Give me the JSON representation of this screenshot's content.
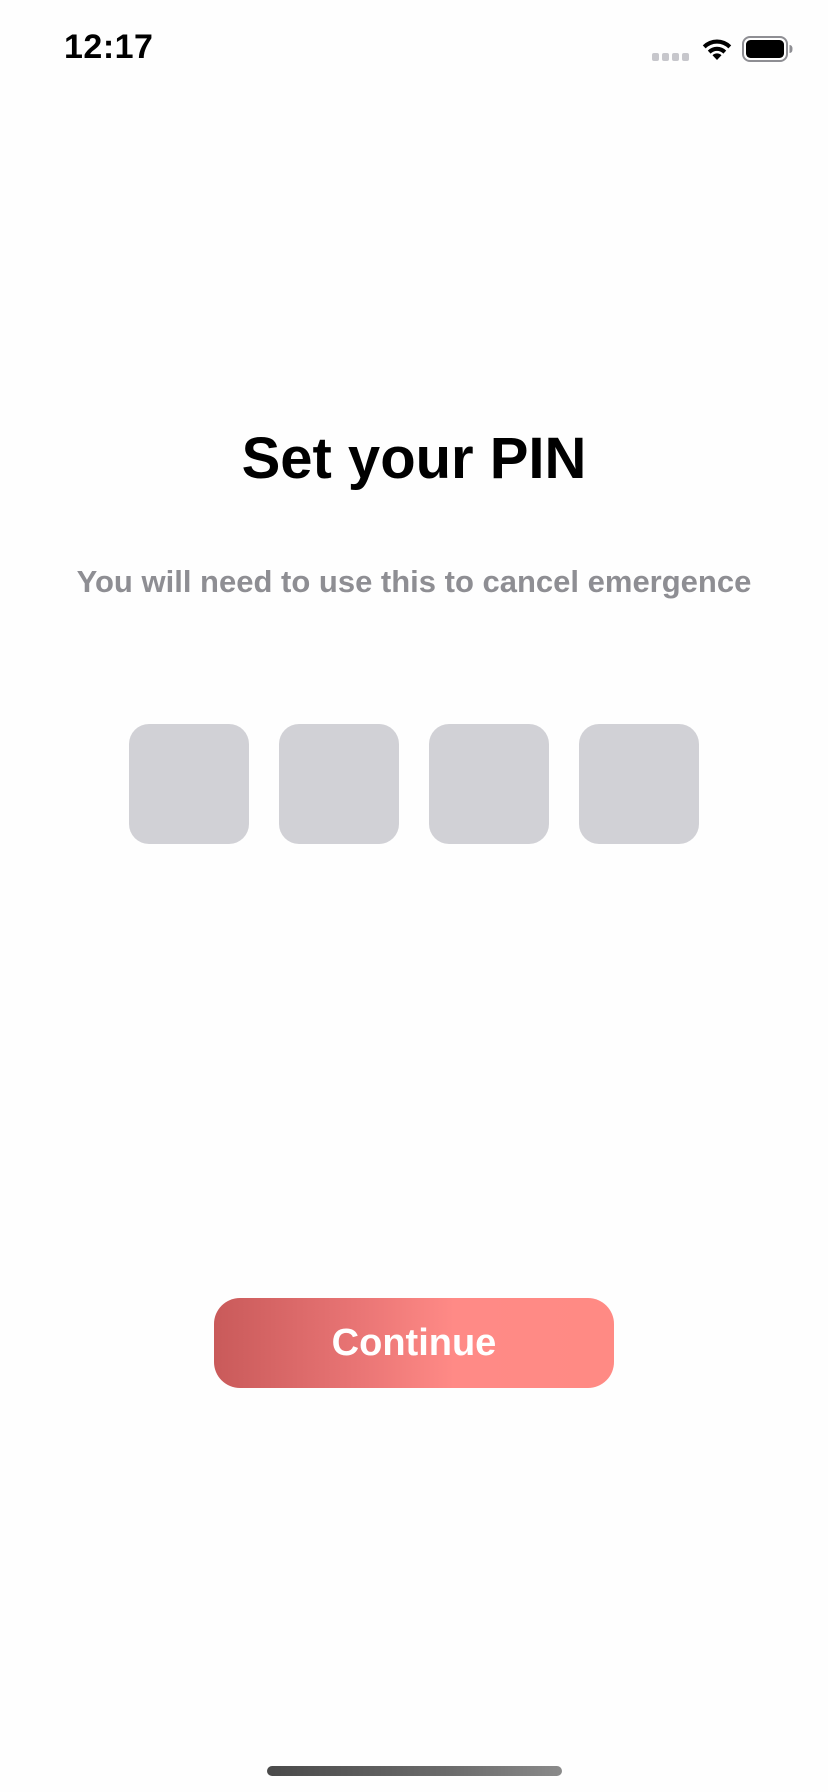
{
  "status_bar": {
    "time": "12:17",
    "icons": [
      "signal-icon",
      "wifi-icon",
      "battery-icon"
    ]
  },
  "pin_setup": {
    "title": "Set your PIN",
    "subtitle": "You will need to use this to cancel emergence",
    "pin_length": 4,
    "digits": [
      "",
      "",
      "",
      ""
    ],
    "box_color": "#d1d1d6"
  },
  "actions": {
    "continue_label": "Continue",
    "button_gradient": [
      "#c95a5a",
      "#ff8a86"
    ]
  }
}
